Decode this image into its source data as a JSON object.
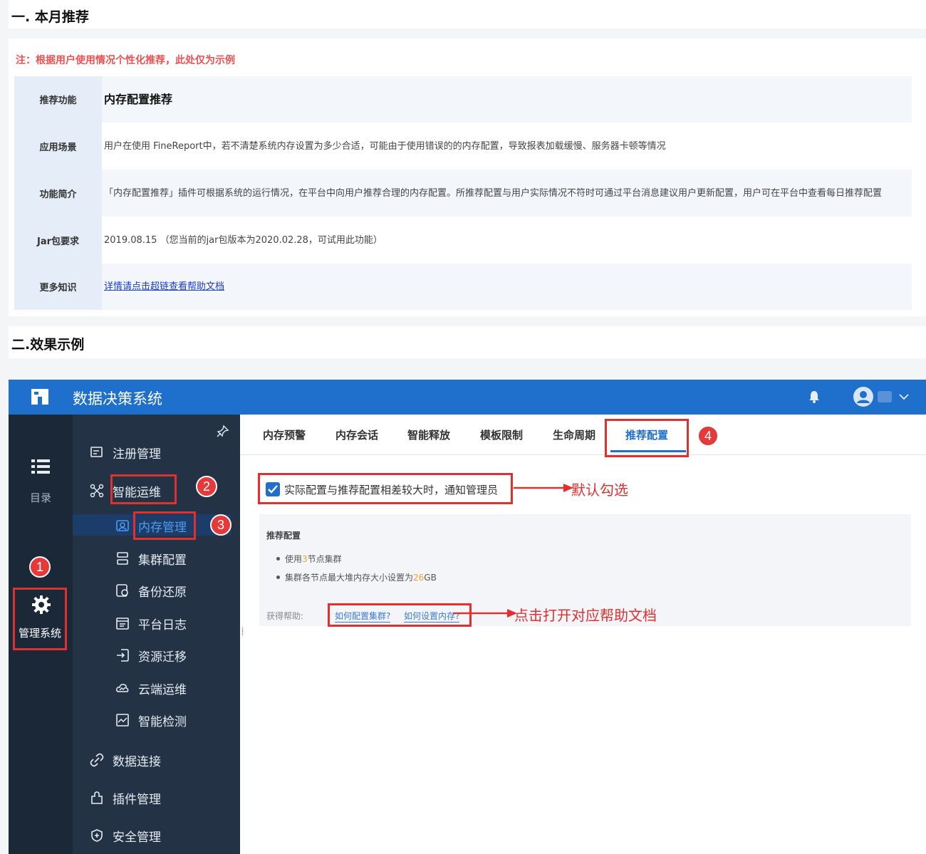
{
  "section1": {
    "heading": "一. 本月推荐",
    "note": "注：根据用户使用情况个性化推荐，此处仅为示例",
    "rows": [
      {
        "key": "推荐功能",
        "value": "内存配置推荐"
      },
      {
        "key": "应用场景",
        "value": "用户在使用 FineReport中，若不清楚系统内存设置为多少合适，可能由于使用错误的的内存配置，导致报表加载缓慢、服务器卡顿等情况"
      },
      {
        "key": "功能简介",
        "value": "「内存配置推荐」插件可根据系统的运行情况，在平台中向用户推荐合理的内存配置。所推荐配置与用户实际情况不符时可通过平台消息建议用户更新配置，用户可在平台中查看每日推荐配置"
      },
      {
        "key": "Jar包要求",
        "value": "2019.08.15 （您当前的jar包版本为2020.02.28，可试用此功能）"
      },
      {
        "key": "更多知识",
        "value": "详情请点击超链查看帮助文档"
      }
    ]
  },
  "section2": {
    "heading": "二.效果示例"
  },
  "app": {
    "title": "数据决策系统",
    "rail": {
      "directory_label": "目录",
      "mgmt_label": "管理系统"
    },
    "menu": {
      "items": [
        {
          "label": "注册管理",
          "icon": "register-icon"
        },
        {
          "label": "智能运维",
          "icon": "ops-icon"
        },
        {
          "label": "内存管理",
          "icon": "memory-icon"
        },
        {
          "label": "集群配置",
          "icon": "cluster-icon"
        },
        {
          "label": "备份还原",
          "icon": "backup-icon"
        },
        {
          "label": "平台日志",
          "icon": "log-icon"
        },
        {
          "label": "资源迁移",
          "icon": "migrate-icon"
        },
        {
          "label": "云端运维",
          "icon": "cloud-icon"
        },
        {
          "label": "智能检测",
          "icon": "detect-icon"
        },
        {
          "label": "数据连接",
          "icon": "link-icon"
        },
        {
          "label": "插件管理",
          "icon": "plugin-icon"
        },
        {
          "label": "安全管理",
          "icon": "shield-icon"
        }
      ]
    },
    "tabs": [
      "内存预警",
      "内存会话",
      "智能释放",
      "模板限制",
      "生命周期",
      "推荐配置"
    ],
    "checkbox_label": "实际配置与推荐配置相差较大时，通知管理员",
    "panel": {
      "title": "推荐配置",
      "bullet1_pre": "使用",
      "bullet1_num": "3",
      "bullet1_post": "节点集群",
      "bullet2_pre": "集群各节点最大堆内存大小设置为",
      "bullet2_num": "26",
      "bullet2_post": "GB",
      "help_label": "获得帮助:",
      "help_link1": "如何配置集群?",
      "help_link2": "如何设置内存?"
    },
    "annotations": {
      "default_checked": "默认勾选",
      "open_help": "点击打开对应帮助文档"
    },
    "badges": [
      "1",
      "2",
      "3",
      "4"
    ]
  },
  "colors": {
    "topbar": "#1f6fcc",
    "rail": "#1b2838",
    "menu": "#243246",
    "highlight": "#e03030",
    "note": "#f05050"
  }
}
